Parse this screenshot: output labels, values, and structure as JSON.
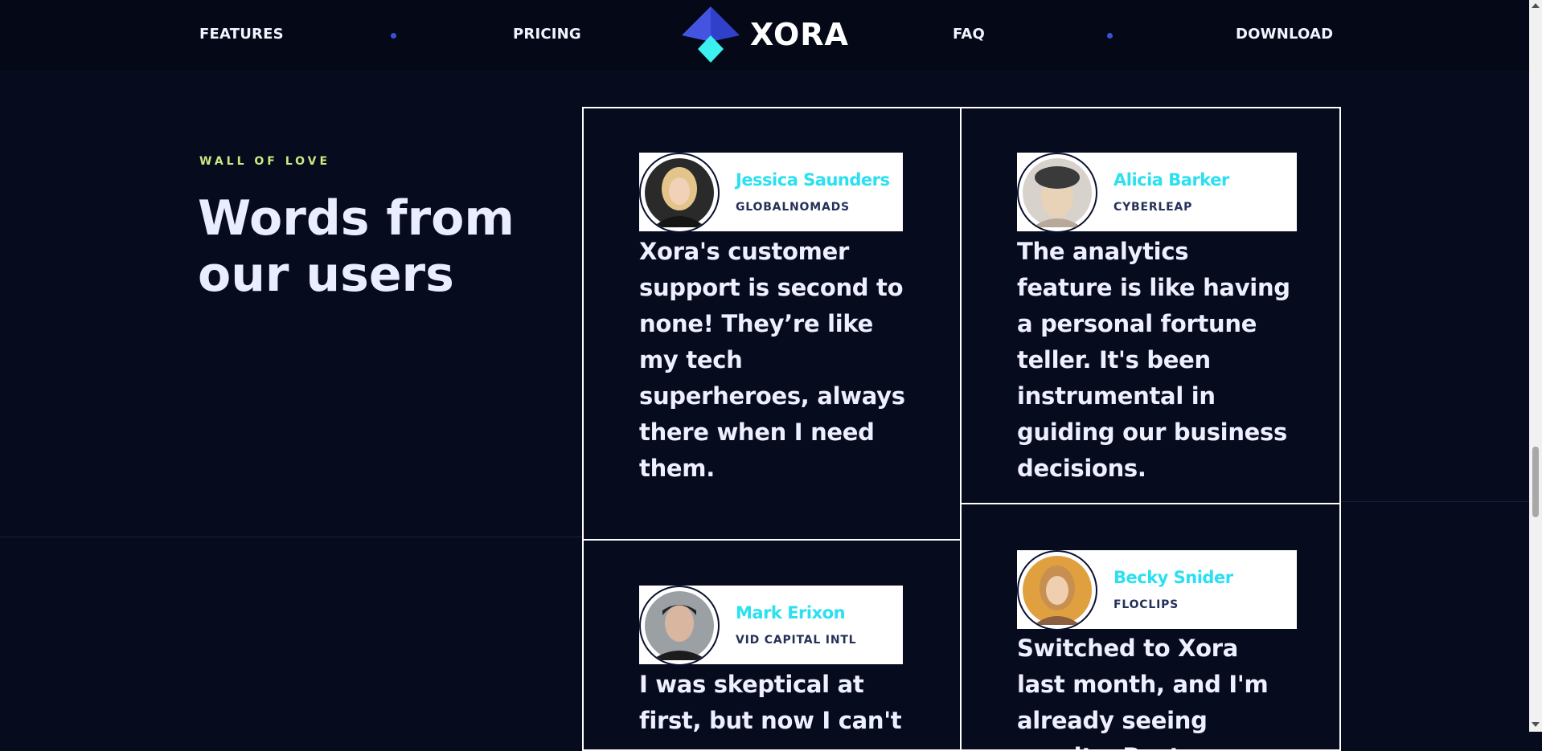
{
  "nav": {
    "links": [
      "FEATURES",
      "PRICING",
      "FAQ",
      "DOWNLOAD"
    ],
    "logo_text": "XORA"
  },
  "section": {
    "eyebrow": "WALL OF LOVE",
    "heading": "Words from our users"
  },
  "testimonials": [
    {
      "name": "Jessica Saunders",
      "company": "GLOBALNOMADS",
      "quote": "Xora's customer support is second to none! They’re like my tech superheroes, always there when I need them."
    },
    {
      "name": "Alicia Barker",
      "company": "CYBERLEAP",
      "quote": "The analytics feature is like having a personal fortune teller. It's been instrumental in guiding our business decisions."
    },
    {
      "name": "Mark Erixon",
      "company": "VID CAPITAL INTL",
      "quote": "I was skeptical at first, but now I can't"
    },
    {
      "name": "Becky Snider",
      "company": "FLOCLIPS",
      "quote": "Switched to Xora last month, and I'm already seeing results. Best"
    }
  ],
  "colors": {
    "background": "#070b1e",
    "accent_cyan": "#2be0f0",
    "eyebrow_green": "#c8ea80",
    "logo_blue": "#4354e0"
  }
}
